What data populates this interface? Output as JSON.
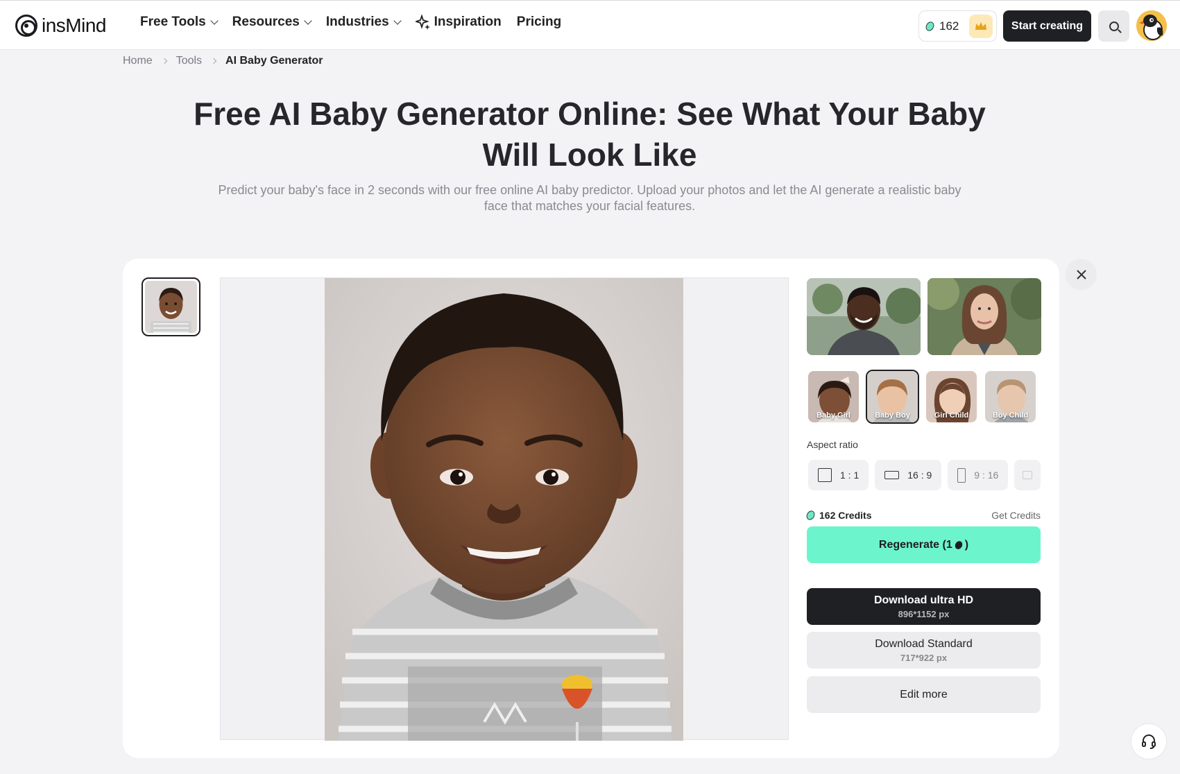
{
  "header": {
    "logo": "insMind",
    "nav": [
      {
        "label": "Free Tools",
        "dropdown": true
      },
      {
        "label": "Resources",
        "dropdown": true
      },
      {
        "label": "Industries",
        "dropdown": true
      },
      {
        "label": "Inspiration",
        "icon": "sparkle-icon"
      },
      {
        "label": "Pricing"
      }
    ],
    "credits": "162",
    "start_label": "Start creating"
  },
  "breadcrumb": [
    "Home",
    "Tools",
    "AI Baby Generator"
  ],
  "hero": {
    "title": "Free AI Baby Generator Online: See What Your Baby Will Look Like",
    "subtitle": "Predict your baby's face in 2 seconds with our free online AI baby predictor. Upload your photos and let the AI generate a realistic baby face that matches your facial features."
  },
  "generator": {
    "styles": [
      {
        "label": "Baby Girl",
        "selected": false
      },
      {
        "label": "Baby Boy",
        "selected": true
      },
      {
        "label": "Girl Child",
        "selected": false
      },
      {
        "label": "Boy Child",
        "selected": false
      }
    ],
    "aspect_label": "Aspect ratio",
    "aspect_options": [
      "1 : 1",
      "16 : 9",
      "9 : 16"
    ],
    "credits_label": "162 Credits",
    "get_credits": "Get Credits",
    "regen_label": "Regenerate (1",
    "regen_suffix": ")",
    "download_hd": "Download ultra HD",
    "download_hd_size": "896*1152 px",
    "download_std": "Download Standard",
    "download_std_size": "717*922 px",
    "edit_more": "Edit more"
  }
}
